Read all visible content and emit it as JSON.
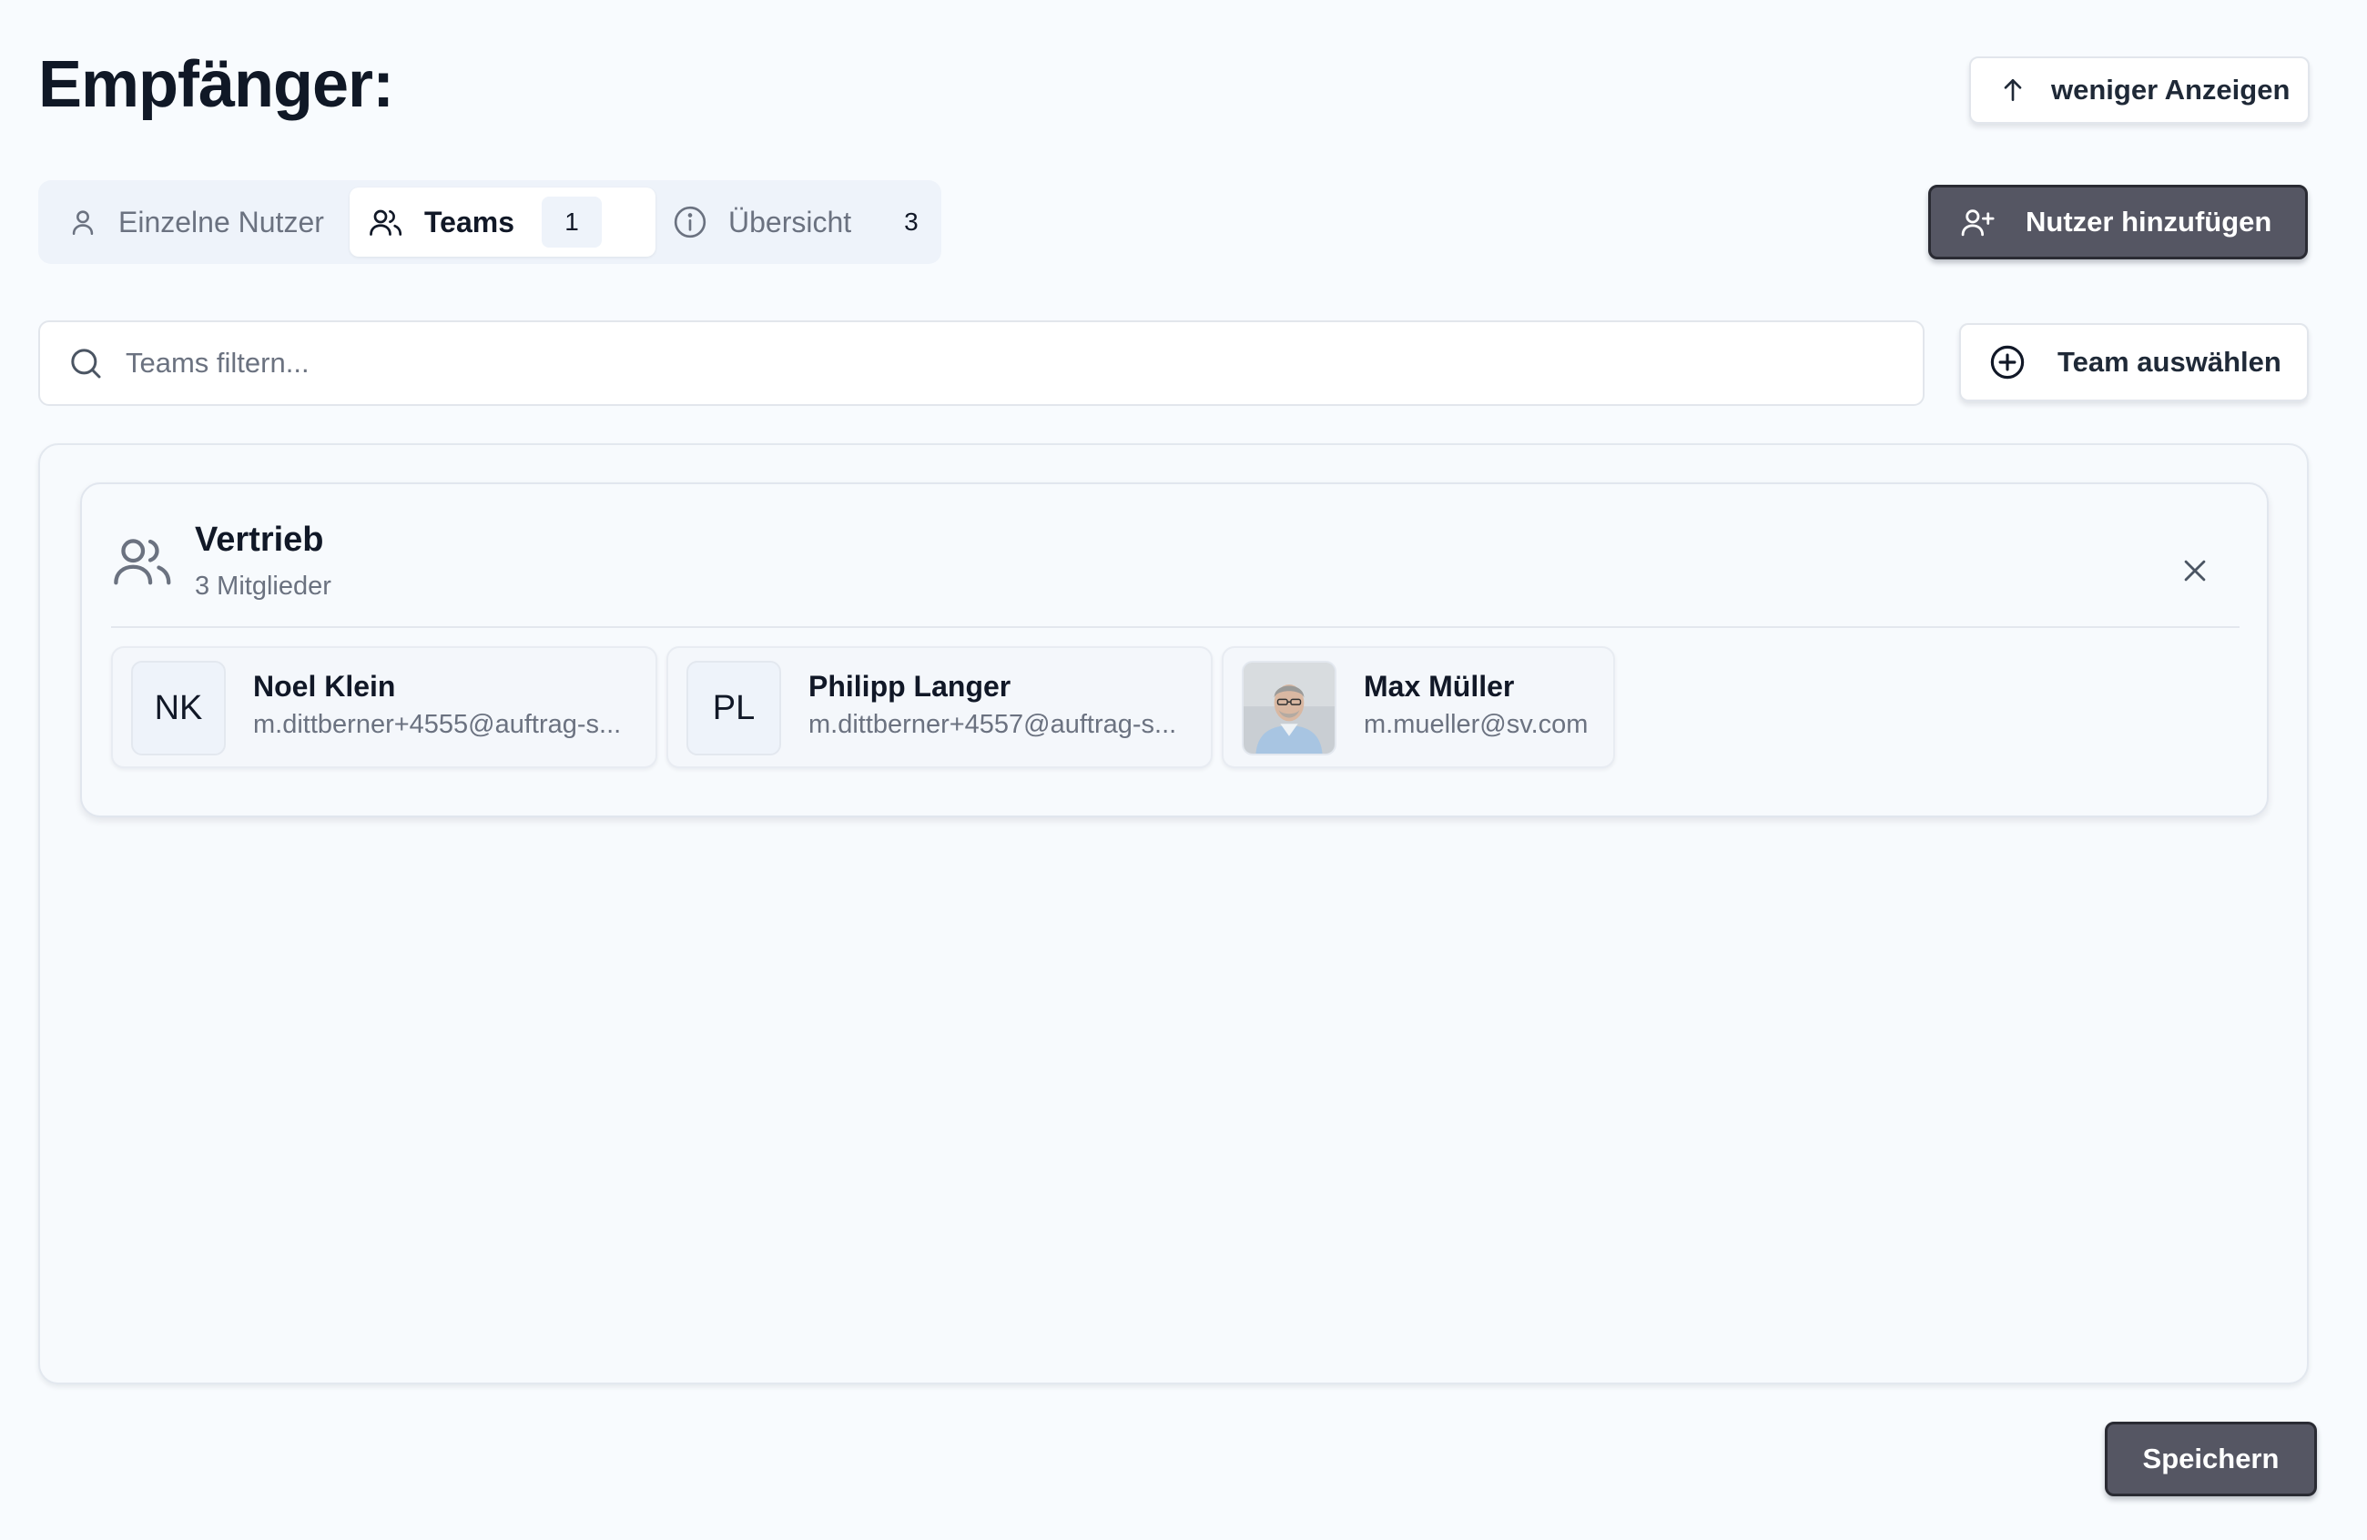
{
  "page": {
    "title": "Empfänger:"
  },
  "header": {
    "less_button": {
      "label": "weniger Anzeigen",
      "icon": "arrow-up-icon"
    }
  },
  "tabs": [
    {
      "label": "Einzelne Nutzer",
      "icon": "user-icon"
    },
    {
      "label": "Teams",
      "icon": "users-icon",
      "badge": "1",
      "active": true
    },
    {
      "label": "Übersicht",
      "icon": "info-icon",
      "count": "3"
    }
  ],
  "actions": {
    "add_user": {
      "label": "Nutzer hinzufügen",
      "icon": "user-plus-icon"
    },
    "select_team": {
      "label": "Team auswählen",
      "icon": "plus-circle-icon"
    },
    "save": {
      "label": "Speichern"
    }
  },
  "search": {
    "placeholder": "Teams filtern...",
    "value": "",
    "icon": "search-icon"
  },
  "team": {
    "name": "Vertrieb",
    "member_count": "3 Mitglieder",
    "icon": "users-icon",
    "members": [
      {
        "initials": "NK",
        "name": "Noel Klein",
        "email": "m.dittberner+4555@auftrag-s..."
      },
      {
        "initials": "PL",
        "name": "Philipp Langer",
        "email": "m.dittberner+4557@auftrag-s..."
      },
      {
        "initials": "",
        "name": "Max Müller",
        "email": "m.mueller@sv.com",
        "avatar": "photo"
      }
    ]
  },
  "colors": {
    "background": "#f8fbfe",
    "primary_dark": "#555663",
    "text": "#111827",
    "muted": "#6b7280",
    "tab_bg": "#eef3fa"
  }
}
